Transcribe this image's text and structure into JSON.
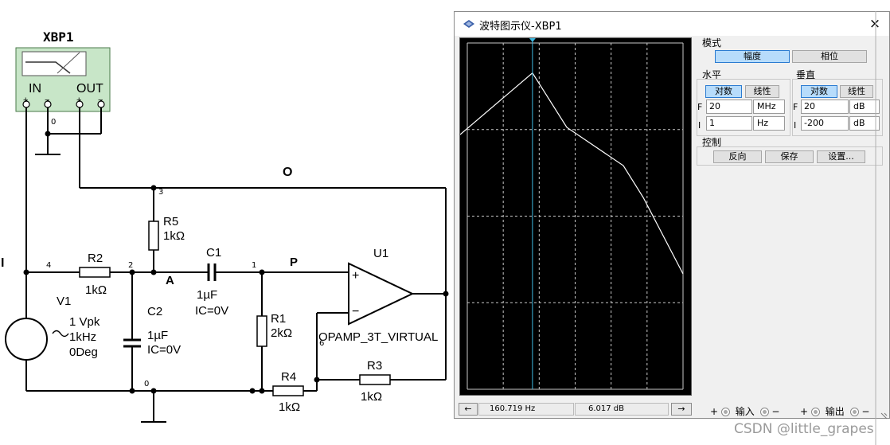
{
  "schematic": {
    "instrument": {
      "name": "XBP1",
      "in_label": "IN",
      "out_label": "OUT",
      "plus": "+",
      "minus": "−"
    },
    "net_labels": {
      "i": "I",
      "o": "O",
      "a": "A",
      "p": "P"
    },
    "node_numbers": {
      "n0_top": "0",
      "n3": "3",
      "n4": "4",
      "n2": "2",
      "n1": "1",
      "n0_bottom": "0",
      "n6": "6"
    },
    "components": {
      "r2": {
        "ref": "R2",
        "value": "1kΩ"
      },
      "r5": {
        "ref": "R5",
        "value": "1kΩ"
      },
      "c1": {
        "ref": "C1",
        "value": "1µF",
        "ic": "IC=0V"
      },
      "c2": {
        "ref": "C2",
        "value": "1µF",
        "ic": "IC=0V"
      },
      "r1": {
        "ref": "R1",
        "value": "2kΩ"
      },
      "r4": {
        "ref": "R4",
        "value": "1kΩ"
      },
      "r3": {
        "ref": "R3",
        "value": "1kΩ"
      },
      "v1": {
        "ref": "V1",
        "amplitude": "1 Vpk",
        "frequency": "1kHz",
        "phase": "0Deg"
      },
      "u1": {
        "ref": "U1",
        "model": "OPAMP_3T_VIRTUAL",
        "plus": "+",
        "minus": "−"
      }
    }
  },
  "bode": {
    "title": "波特图示仪-XBP1",
    "close_icon": "×",
    "mode": {
      "label": "模式",
      "magnitude": "幅度",
      "phase": "相位",
      "active": "magnitude"
    },
    "horizontal": {
      "label": "水平",
      "log": "对数",
      "linear": "线性",
      "active": "log",
      "f": {
        "letter": "F",
        "value": "20",
        "unit": "MHz"
      },
      "i": {
        "letter": "I",
        "value": "1",
        "unit": "Hz"
      }
    },
    "vertical": {
      "label": "垂直",
      "log": "对数",
      "linear": "线性",
      "active": "log",
      "f": {
        "letter": "F",
        "value": "20",
        "unit": "dB"
      },
      "i": {
        "letter": "I",
        "value": "-200",
        "unit": "dB"
      }
    },
    "control": {
      "label": "控制",
      "reverse": "反向",
      "save": "保存",
      "settings": "设置..."
    },
    "status": {
      "left_arrow": "←",
      "right_arrow": "→",
      "frequency": "160.719  Hz",
      "gain": "6.017 dB"
    },
    "terminals": {
      "input": {
        "plus": "+",
        "label": "输入",
        "minus": "−"
      },
      "output": {
        "plus": "+",
        "label": "输出",
        "minus": "−"
      }
    },
    "plot": {
      "background": "#000000",
      "trace_color": "#ffffff",
      "grid_color": "#c8c8c8",
      "cursor_color": "#3fb9e0",
      "cursor_frequency_hz": 160.719,
      "cursor_gain_db": 6.017
    }
  },
  "watermark": "CSDN @little_grapes"
}
